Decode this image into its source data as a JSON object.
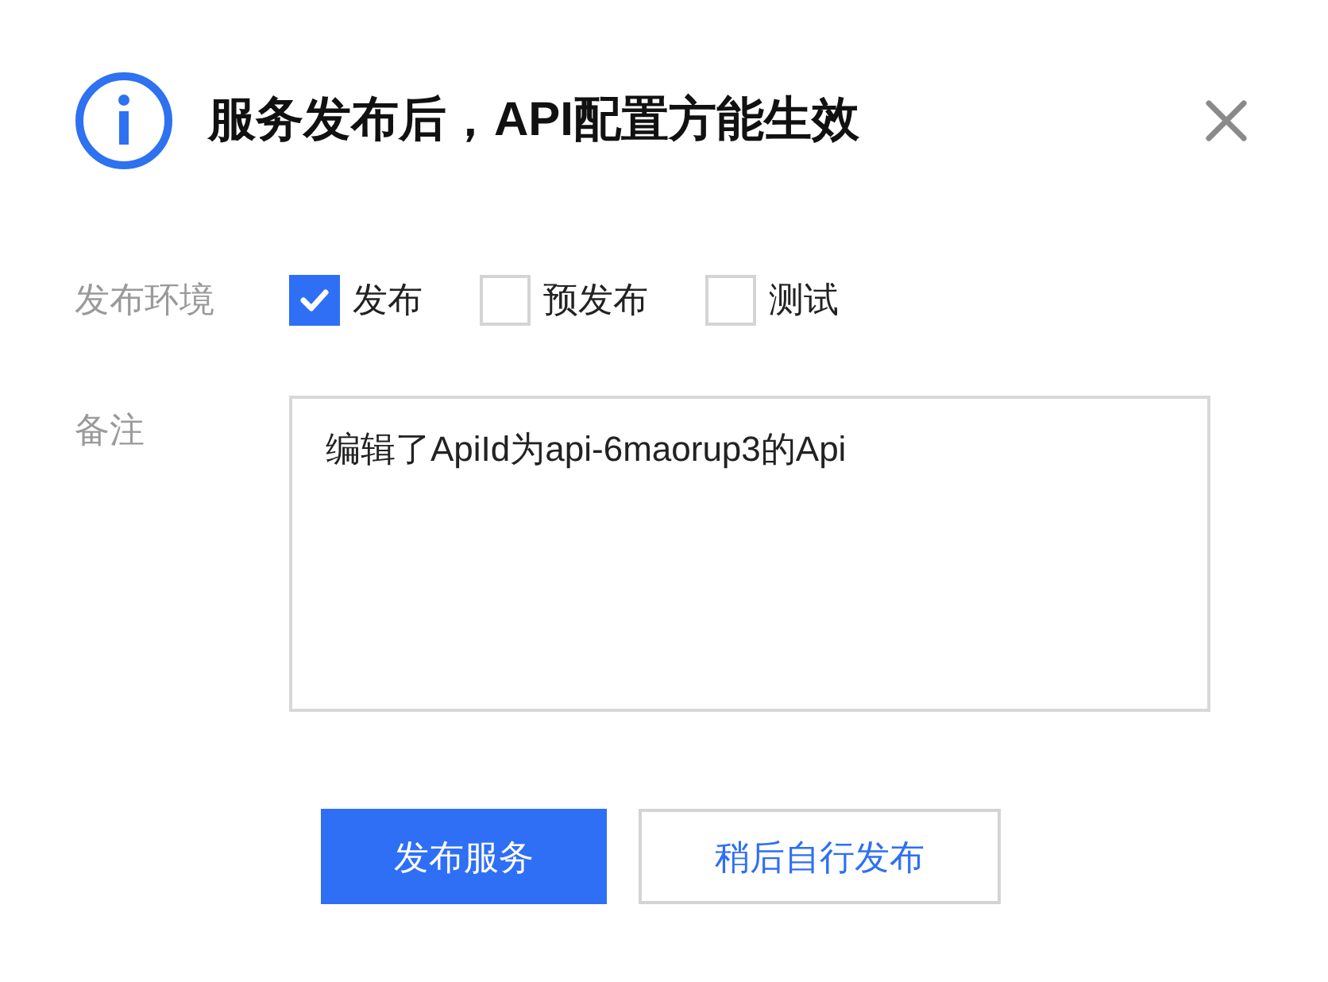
{
  "dialog": {
    "title": "服务发布后，API配置方能生效"
  },
  "environment": {
    "label": "发布环境",
    "options": [
      {
        "label": "发布",
        "checked": true
      },
      {
        "label": "预发布",
        "checked": false
      },
      {
        "label": "测试",
        "checked": false
      }
    ]
  },
  "remark": {
    "label": "备注",
    "value": "编辑了ApiId为api-6maorup3的Api"
  },
  "buttons": [
    {
      "label": "发布服务",
      "kind": "primary"
    },
    {
      "label": "稍后自行发布",
      "kind": "secondary"
    }
  ]
}
